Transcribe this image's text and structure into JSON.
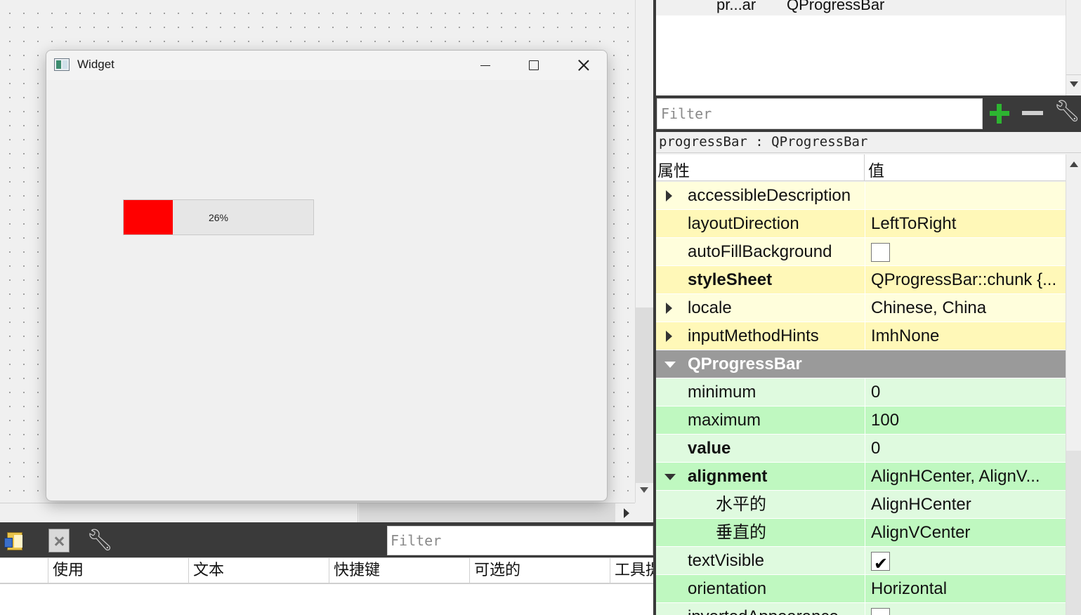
{
  "form": {
    "title": "Widget",
    "progress": {
      "value": 26,
      "text": "26%",
      "chunk_color": "#ff0000"
    }
  },
  "object_inspector": {
    "row_object": "pr...ar",
    "row_class": "QProgressBar"
  },
  "property_editor": {
    "filter_placeholder": "Filter",
    "object_label": "progressBar : QProgressBar",
    "col_property": "属性",
    "col_value": "值",
    "rows": [
      {
        "name": "accessibleDescription",
        "value": ""
      },
      {
        "name": "layoutDirection",
        "value": "LeftToRight"
      },
      {
        "name": "autoFillBackground",
        "checked": false
      },
      {
        "name": "styleSheet",
        "value": "QProgressBar::chunk {..."
      },
      {
        "name": "locale",
        "value": "Chinese, China"
      },
      {
        "name": "inputMethodHints",
        "value": "ImhNone"
      },
      {
        "name": "QProgressBar"
      },
      {
        "name": "minimum",
        "value": "0"
      },
      {
        "name": "maximum",
        "value": "100"
      },
      {
        "name": "value",
        "value": "0"
      },
      {
        "name": "alignment",
        "value": "AlignHCenter, AlignV..."
      },
      {
        "name": "水平的",
        "value": "AlignHCenter"
      },
      {
        "name": "垂直的",
        "value": "AlignVCenter"
      },
      {
        "name": "textVisible",
        "checked": true
      },
      {
        "name": "orientation",
        "value": "Horizontal"
      },
      {
        "name": "invertedAppearance",
        "checked": false
      }
    ]
  },
  "action_editor": {
    "filter_placeholder": "Filter",
    "columns": [
      "使用",
      "文本",
      "快捷键",
      "可选的",
      "工具提示"
    ]
  }
}
